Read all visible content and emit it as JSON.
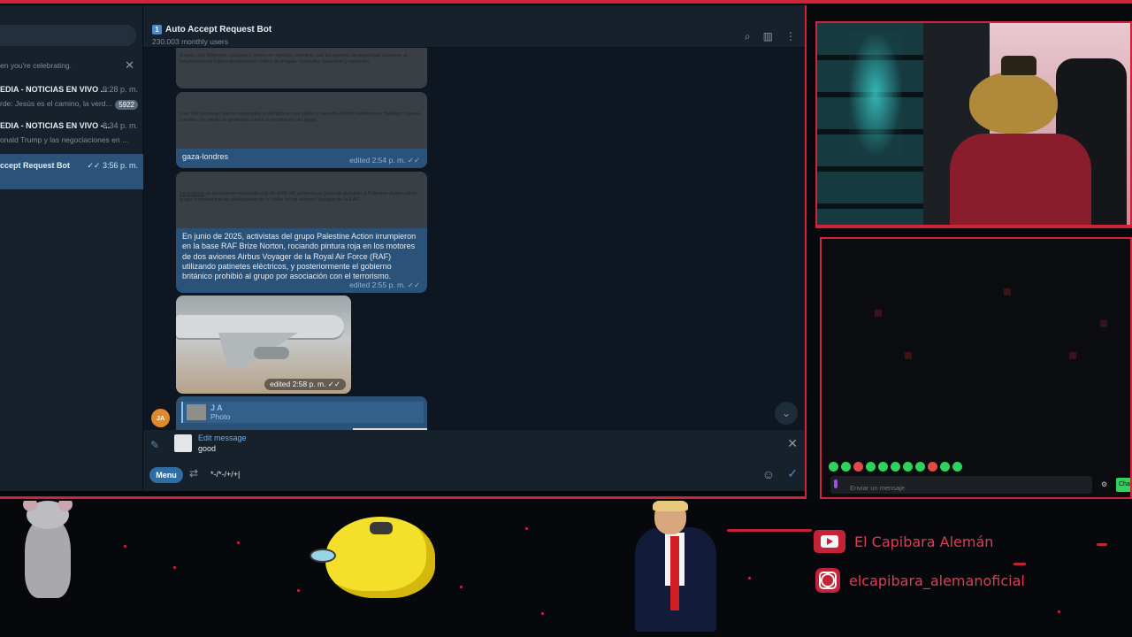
{
  "window": {
    "controls": [
      "—",
      "☐",
      "✕"
    ]
  },
  "sidebar": {
    "notice": "en you're celebrating.",
    "notice_close": "✕",
    "chats": [
      {
        "name": "EDIA - NOTICIAS EN VIVO ...",
        "time": "9:28 p. m.",
        "preview": "rde: Jesús es el camino, la verd...",
        "badge": "5922"
      },
      {
        "name": "EDIA - NOTICIAS EN VIVO -...",
        "time": "8:34 p. m.",
        "preview": "onald Trump y las negociaciones en ..."
      },
      {
        "name": "ccept Request Bot",
        "time": "✓✓ 3:56 p. m."
      }
    ]
  },
  "chat_header": {
    "title_icon": "1",
    "title": "Auto Accept Request Bot",
    "subtitle": "230.003 monthly users",
    "icons": [
      "search-icon",
      "sidebar-icon",
      "more-icon"
    ]
  },
  "messages": {
    "m1_shot": "drogas, dos teléfonos celulares y dinero en efectivo, mientras que los agentes de seguridad acusaron al sospechoso de tráfico de personas, tráfico de drogas, homicidio, secuestro y extorsión.",
    "m2_shot": "Casi 500 personas fueron arrestadas el sábado en una vigilia a favor de Acción Palestina en Trafalgar Square, Londres, en medio de protestas contra la prohibición del grupo.",
    "m2_text": "gaza-londres",
    "m2_meta": "edited 2:54 p. m. ✓✓",
    "m3_shot_link": "La protesta",
    "m3_shot": " se produjo en respuesta a la decisión del gobierno en junio de designar a Palestine Action como grupo terrorista tras su participación en el daño de los aviones Voyager de la RAF.",
    "m3_text": "En junio de 2025, activistas del grupo Palestine Action irrumpieron en la base RAF Brize Norton, rociando pintura roja en los motores de dos aviones Airbus Voyager de la Royal Air Force (RAF) utilizando patinetes eléctricos, y posteriormente el gobierno británico prohibió al grupo por asociación con el terrorismo.",
    "m3_meta": "edited 2:55 p. m. ✓✓",
    "photo_meta": "edited 2:58 p. m. ✓✓",
    "reply_name": "J A",
    "reply_type": "Photo",
    "avatar": "JA",
    "scroll_down": "⌄"
  },
  "edit_bar": {
    "label": "Edit message",
    "text": "good",
    "close": "✕"
  },
  "input_bar": {
    "menu": "Menu",
    "value": "*-/*-/+/+|",
    "emoji": "☺",
    "send": "✓"
  },
  "stream_chat": {
    "placeholder": "Enviar un mensaje",
    "button": "Cha",
    "gear": "⚙"
  },
  "socials": {
    "youtube": "El Capibara Alemán",
    "instagram": "elcapibara_alemanoficial"
  },
  "colors": {
    "accent": "#d0243b",
    "telegram_bg": "#0e1621",
    "bubble": "#2b5278",
    "link": "#6ab2f2"
  }
}
